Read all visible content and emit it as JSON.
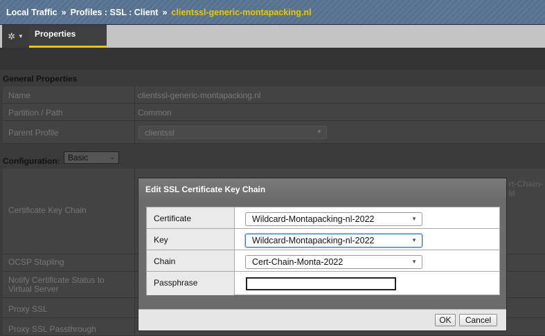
{
  "breadcrumb": {
    "part1": "Local Traffic",
    "sep": "»",
    "part2": "Profiles : SSL : Client",
    "current": "clientssl-generic-montapacking.nl"
  },
  "toolbar": {
    "gear_icon": "gear-icon",
    "tab_properties": "Properties"
  },
  "general": {
    "heading": "General Properties",
    "rows": [
      {
        "label": "Name",
        "value": "clientssl-generic-montapacking.nl"
      },
      {
        "label": "Partition / Path",
        "value": "Common"
      },
      {
        "label": "Parent Profile",
        "value": "clientssl"
      }
    ]
  },
  "configuration": {
    "heading": "Configuration:",
    "mode": "Basic"
  },
  "settings_labels": {
    "cert_key_chain": "Certificate Key Chain",
    "ocsp": "OCSP Stapling",
    "notify_line1": "Notify Certificate Status to",
    "notify_line2": "Virtual Server",
    "proxy_ssl": "Proxy SSL",
    "proxy_passthrough": "Proxy SSL Passthrough"
  },
  "background_fragment": "rt-Chain-M",
  "dialog": {
    "title": "Edit SSL Certificate Key Chain",
    "rows": [
      {
        "label": "Certificate",
        "value": "Wildcard-Montapacking-nl-2022"
      },
      {
        "label": "Key",
        "value": "Wildcard-Montapacking-nl-2022"
      },
      {
        "label": "Chain",
        "value": "Cert-Chain-Monta-2022"
      },
      {
        "label": "Passphrase",
        "value": ""
      }
    ],
    "ok_label": "OK",
    "cancel_label": "Cancel"
  }
}
